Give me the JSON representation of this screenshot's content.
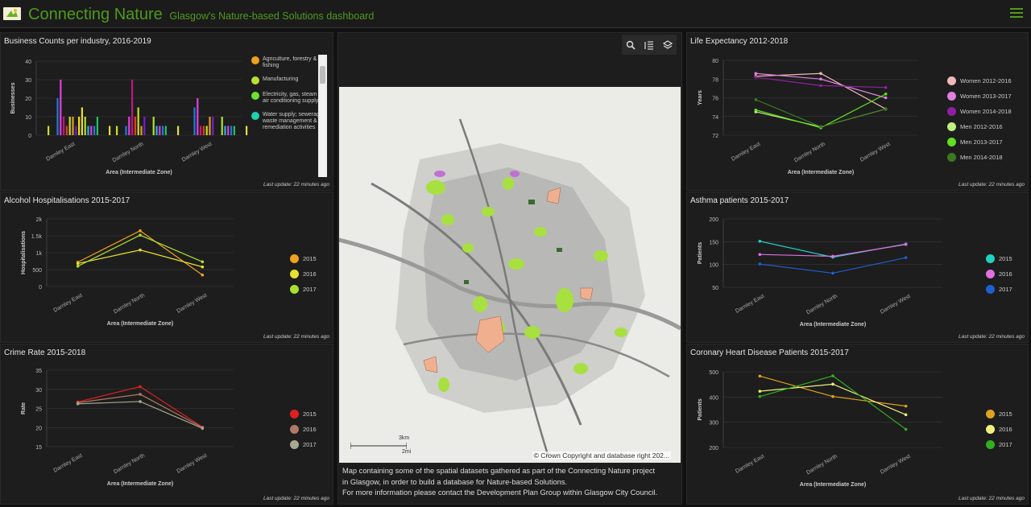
{
  "header": {
    "title": "Connecting Nature",
    "subtitle": "Glasgow's Nature-based Solutions dashboard"
  },
  "last_update": "Last update: 22 minutes ago",
  "zones": [
    "Darnley East",
    "Darnley North",
    "Darnley West"
  ],
  "xlabel": "Area (Intermediate Zone)",
  "panels": {
    "business": {
      "title": "Business Counts per industry, 2016-2019",
      "ylabel": "Businesses",
      "legend": [
        "Agriculture, forestry & fishing",
        "Manufacturing",
        "Electricity, gas, steam & air conditioning supply",
        "Water supply; sewerage, waste management & remediation activities"
      ]
    },
    "alcohol": {
      "title": "Alcohol Hospitalisations 2015-2017",
      "ylabel": "Hospitalisations"
    },
    "crime": {
      "title": "Crime Rate 2015-2018",
      "ylabel": "Rate"
    },
    "life": {
      "title": "Life Expectancy 2012-2018",
      "ylabel": "Years"
    },
    "asthma": {
      "title": "Asthma patients 2015-2017",
      "ylabel": "Patients"
    },
    "chd": {
      "title": "Coronary Heart Disease Patients 2015-2017",
      "ylabel": "Patients"
    }
  },
  "map": {
    "caption": [
      "Map containing some of the spatial datasets gathered as part of the Connecting Nature project",
      "in Glasgow, in order to build a database for Nature-based Solutions.",
      "For more information please contact the Development Plan Group within Glasgow City Council."
    ],
    "copyright": "© Crown Copyright and database right 202...",
    "scale_km": "3km",
    "scale_mi": "2mi",
    "tools": [
      "search-icon",
      "legend-icon",
      "layers-icon"
    ]
  },
  "chart_data": [
    {
      "type": "bar",
      "title": "Business Counts per industry, 2016-2019",
      "ylabel": "Businesses",
      "xlabel": "Area (Intermediate Zone)",
      "categories": [
        "Darnley East",
        "Darnley North",
        "Darnley West"
      ],
      "ylim": [
        0,
        40
      ],
      "yticks": [
        0,
        10,
        20,
        30,
        40
      ],
      "bar_colors": [
        "#c8e020",
        "#1f7bd8",
        "#23c8d8",
        "#1f7bd8",
        "#e040e0",
        "#c01880",
        "#e04020",
        "#c8e020",
        "#e0a020",
        "#7820c8",
        "#f0e020",
        "#f0e020",
        "#b0e030",
        "#30b0e0",
        "#e040e0",
        "#1f7bd8",
        "#20c060",
        "#9030c0",
        "#e0e040",
        "#d040c0",
        "#e0e040",
        "#23c8d8"
      ],
      "values": [
        [
          5,
          0,
          0,
          20,
          30,
          10,
          5,
          10,
          10,
          5,
          10,
          15,
          10,
          5,
          5,
          5,
          10,
          0,
          0,
          0,
          5,
          0
        ],
        [
          5,
          0,
          0,
          5,
          10,
          30,
          10,
          15,
          5,
          10,
          0,
          0,
          10,
          5,
          5,
          5,
          5,
          0,
          0,
          0,
          5,
          0
        ],
        [
          0,
          0,
          0,
          15,
          20,
          5,
          5,
          5,
          10,
          10,
          0,
          0,
          10,
          5,
          5,
          5,
          5,
          0,
          0,
          0,
          5,
          0
        ]
      ]
    },
    {
      "type": "line",
      "title": "Alcohol Hospitalisations 2015-2017",
      "ylabel": "Hospitalisations",
      "xlabel": "Area (Intermediate Zone)",
      "categories": [
        "Darnley East",
        "Darnley North",
        "Darnley West"
      ],
      "ylim": [
        0,
        2000
      ],
      "ytick_labels": [
        "0",
        "500",
        "1k",
        "1.5k",
        "2k"
      ],
      "series": [
        {
          "name": "2015",
          "color": "#f0a020",
          "values": [
            720,
            1650,
            340
          ]
        },
        {
          "name": "2016",
          "color": "#e8e030",
          "values": [
            680,
            1080,
            580
          ]
        },
        {
          "name": "2017",
          "color": "#a8e030",
          "values": [
            600,
            1520,
            730
          ]
        }
      ]
    },
    {
      "type": "line",
      "title": "Crime Rate 2015-2018",
      "ylabel": "Rate",
      "xlabel": "Area (Intermediate Zone)",
      "categories": [
        "Darnley East",
        "Darnley North",
        "Darnley West"
      ],
      "ylim": [
        15,
        35
      ],
      "ytick_labels": [
        "15",
        "20",
        "25",
        "30",
        "35"
      ],
      "series": [
        {
          "name": "2015",
          "color": "#e02020",
          "values": [
            26.7,
            30.7,
            20.1
          ]
        },
        {
          "name": "2016",
          "color": "#b07868",
          "values": [
            26.5,
            28.7,
            20.0
          ]
        },
        {
          "name": "2017",
          "color": "#a8a890",
          "values": [
            26.2,
            26.8,
            19.8
          ]
        }
      ]
    },
    {
      "type": "line",
      "title": "Life Expectancy 2012-2018",
      "ylabel": "Years",
      "xlabel": "Area (Intermediate Zone)",
      "categories": [
        "Darnley East",
        "Darnley North",
        "Darnley West"
      ],
      "ylim": [
        72,
        80
      ],
      "ytick_labels": [
        "72",
        "74",
        "76",
        "78",
        "80"
      ],
      "series": [
        {
          "name": "Women 2012-2016",
          "color": "#f0b8b8",
          "values": [
            78.3,
            78.6,
            74.8
          ]
        },
        {
          "name": "Women 2013-2017",
          "color": "#e080e0",
          "values": [
            78.6,
            78.0,
            76.0
          ]
        },
        {
          "name": "Women 2014-2018",
          "color": "#9020a0",
          "values": [
            78.2,
            77.3,
            77.1
          ]
        },
        {
          "name": "Men 2012-2016",
          "color": "#c0f080",
          "values": [
            74.5,
            72.9,
            74.8
          ]
        },
        {
          "name": "Men 2013-2017",
          "color": "#60e020",
          "values": [
            74.7,
            72.8,
            76.4
          ]
        },
        {
          "name": "Men 2014-2018",
          "color": "#3a7a20",
          "values": [
            75.8,
            72.9,
            74.8
          ]
        }
      ]
    },
    {
      "type": "line",
      "title": "Asthma patients 2015-2017",
      "ylabel": "Patients",
      "xlabel": "Area (Intermediate Zone)",
      "categories": [
        "Darnley East",
        "Darnley North",
        "Darnley West"
      ],
      "ylim": [
        50,
        200
      ],
      "ytick_labels": [
        "50",
        "100",
        "150",
        "200"
      ],
      "series": [
        {
          "name": "2015",
          "color": "#20d0c0",
          "values": [
            151,
            116,
            145
          ]
        },
        {
          "name": "2016",
          "color": "#e070e0",
          "values": [
            122,
            118,
            144
          ]
        },
        {
          "name": "2017",
          "color": "#1f60d0",
          "values": [
            101,
            81,
            115
          ]
        }
      ]
    },
    {
      "type": "line",
      "title": "Coronary Heart Disease Patients 2015-2017",
      "ylabel": "Patients",
      "xlabel": "Area (Intermediate Zone)",
      "categories": [
        "Darnley East",
        "Darnley North",
        "Darnley West"
      ],
      "ylim": [
        200,
        500
      ],
      "ytick_labels": [
        "200",
        "300",
        "400",
        "500"
      ],
      "series": [
        {
          "name": "2015",
          "color": "#e0a020",
          "values": [
            483,
            402,
            364
          ]
        },
        {
          "name": "2016",
          "color": "#f0f080",
          "values": [
            423,
            451,
            330
          ]
        },
        {
          "name": "2017",
          "color": "#30b020",
          "values": [
            402,
            484,
            272
          ]
        }
      ]
    }
  ],
  "business_legend_colors": [
    "#f0a020",
    "#b8e030",
    "#70e030",
    "#20d0b0"
  ]
}
